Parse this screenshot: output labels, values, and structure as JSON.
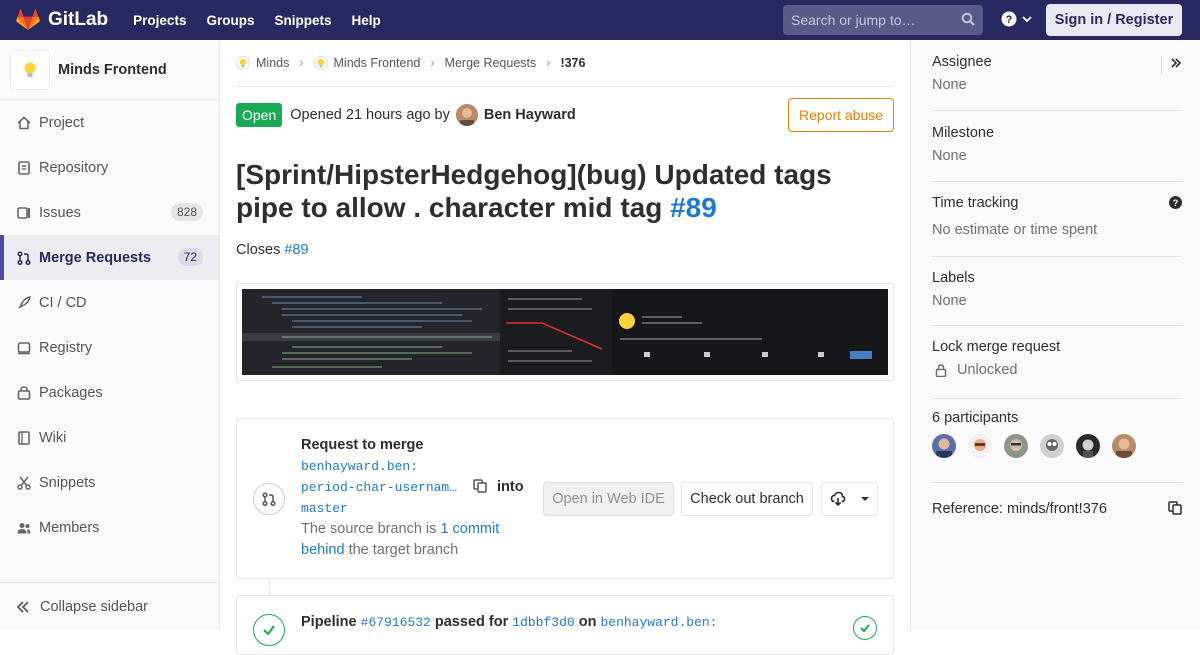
{
  "navbar": {
    "brand": "GitLab",
    "links": [
      "Projects",
      "Groups",
      "Snippets",
      "Help"
    ],
    "search_placeholder": "Search or jump to…",
    "sign_in": "Sign in / Register"
  },
  "sidebar": {
    "project_name": "Minds Frontend",
    "items": [
      {
        "label": "Project",
        "icon": "home-icon"
      },
      {
        "label": "Repository",
        "icon": "doc-icon"
      },
      {
        "label": "Issues",
        "icon": "issues-icon",
        "count": "828"
      },
      {
        "label": "Merge Requests",
        "icon": "merge-request-icon",
        "count": "72"
      },
      {
        "label": "CI / CD",
        "icon": "rocket-icon"
      },
      {
        "label": "Registry",
        "icon": "registry-icon"
      },
      {
        "label": "Packages",
        "icon": "package-icon"
      },
      {
        "label": "Wiki",
        "icon": "book-icon"
      },
      {
        "label": "Snippets",
        "icon": "scissors-icon"
      },
      {
        "label": "Members",
        "icon": "users-icon"
      }
    ],
    "collapse_label": "Collapse sidebar"
  },
  "breadcrumbs": [
    "Minds",
    "Minds Frontend",
    "Merge Requests",
    "!376"
  ],
  "mr": {
    "status": "Open",
    "opened_text": "Opened 21 hours ago by",
    "author": "Ben Hayward",
    "report_label": "Report abuse",
    "title": "[Sprint/HipsterHedgehog](bug) Updated tags pipe to allow . character mid tag",
    "title_ref": "#89",
    "closes_prefix": "Closes",
    "closes_ref": "#89"
  },
  "merge_widget": {
    "heading": "Request to merge",
    "source_branch_1": "benhayward.ben:",
    "source_branch_2": "period-char-usernam…",
    "into_label": "into",
    "target_branch": "master",
    "behind_prefix": "The source branch is",
    "behind_link": "1 commit behind",
    "behind_suffix": "the target branch",
    "web_ide_label": "Open in Web IDE",
    "checkout_label": "Check out branch"
  },
  "pipeline": {
    "prefix": "Pipeline",
    "id": "#67916532",
    "passed_for": "passed for",
    "commit": "1dbbf3d0",
    "on": "on",
    "branch": "benhayward.ben:"
  },
  "right_sidebar": {
    "assignee_label": "Assignee",
    "assignee_value": "None",
    "milestone_label": "Milestone",
    "milestone_value": "None",
    "time_label": "Time tracking",
    "time_value": "No estimate or time spent",
    "labels_label": "Labels",
    "labels_value": "None",
    "lock_label": "Lock merge request",
    "lock_value": "Unlocked",
    "participants_label": "6 participants",
    "reference_label": "Reference: minds/front!376"
  },
  "colors": {
    "navbar": "#292961",
    "open_badge": "#1aaa55",
    "link": "#1f78d1",
    "report": "#e07e00"
  }
}
